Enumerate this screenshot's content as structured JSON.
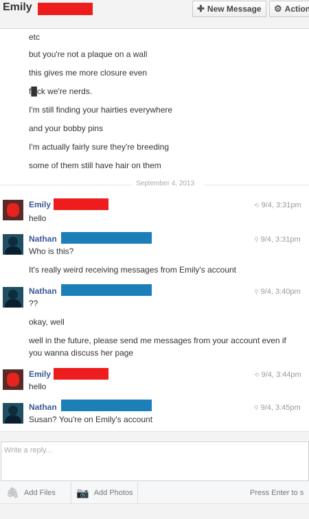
{
  "header": {
    "name": "Emily",
    "new_message_label": "New Message",
    "actions_label": "Action",
    "redact_color": "#ee1c1c"
  },
  "earlier_messages": [
    "etc",
    "but you're not a plaque on a wall",
    "this gives me more closure even",
    "f█ck we're nerds.",
    "I'm still finding your hairties everywhere",
    "and your bobby pins",
    "I'm actually fairly sure they're breeding",
    "some of them still have hair on them"
  ],
  "date_separator": "September 4, 2013",
  "threads": [
    {
      "sender": "Emily",
      "redact_color": "#ee1c1c",
      "avatar": "emily-avatar",
      "timestamp": "9/4, 3:31pm",
      "timestamp_icon": "reply-icon",
      "lines": [
        "hello"
      ]
    },
    {
      "sender": "Nathan",
      "redact_color": "#1c7fb8",
      "avatar": "nathan-avatar",
      "timestamp": "9/4, 3:31pm",
      "timestamp_icon": "location-pin-icon",
      "lines": [
        "Who is this?",
        "It's really weird receiving messages from Emily's account"
      ]
    },
    {
      "sender": "Nathan",
      "redact_color": "#1c7fb8",
      "avatar": "nathan-avatar",
      "timestamp": "9/4, 3:40pm",
      "timestamp_icon": "location-pin-icon",
      "lines": [
        "??",
        "okay, well",
        "well in the future, please send me messages from your account even if",
        "you wanna discuss her page"
      ]
    },
    {
      "sender": "Emily",
      "redact_color": "#ee1c1c",
      "avatar": "emily-avatar",
      "timestamp": "9/4, 3:44pm",
      "timestamp_icon": "reply-icon",
      "lines": [
        "hello"
      ]
    },
    {
      "sender": "Nathan",
      "redact_color": "#1c7fb8",
      "avatar": "nathan-avatar",
      "timestamp": "9/4, 3:45pm",
      "timestamp_icon": "location-pin-icon",
      "lines": [
        "Susan? You're on Emily's account"
      ]
    }
  ],
  "composer": {
    "placeholder": "Write a reply...",
    "add_files_label": "Add Files",
    "add_photos_label": "Add Photos",
    "enter_hint": "Press Enter to s"
  }
}
